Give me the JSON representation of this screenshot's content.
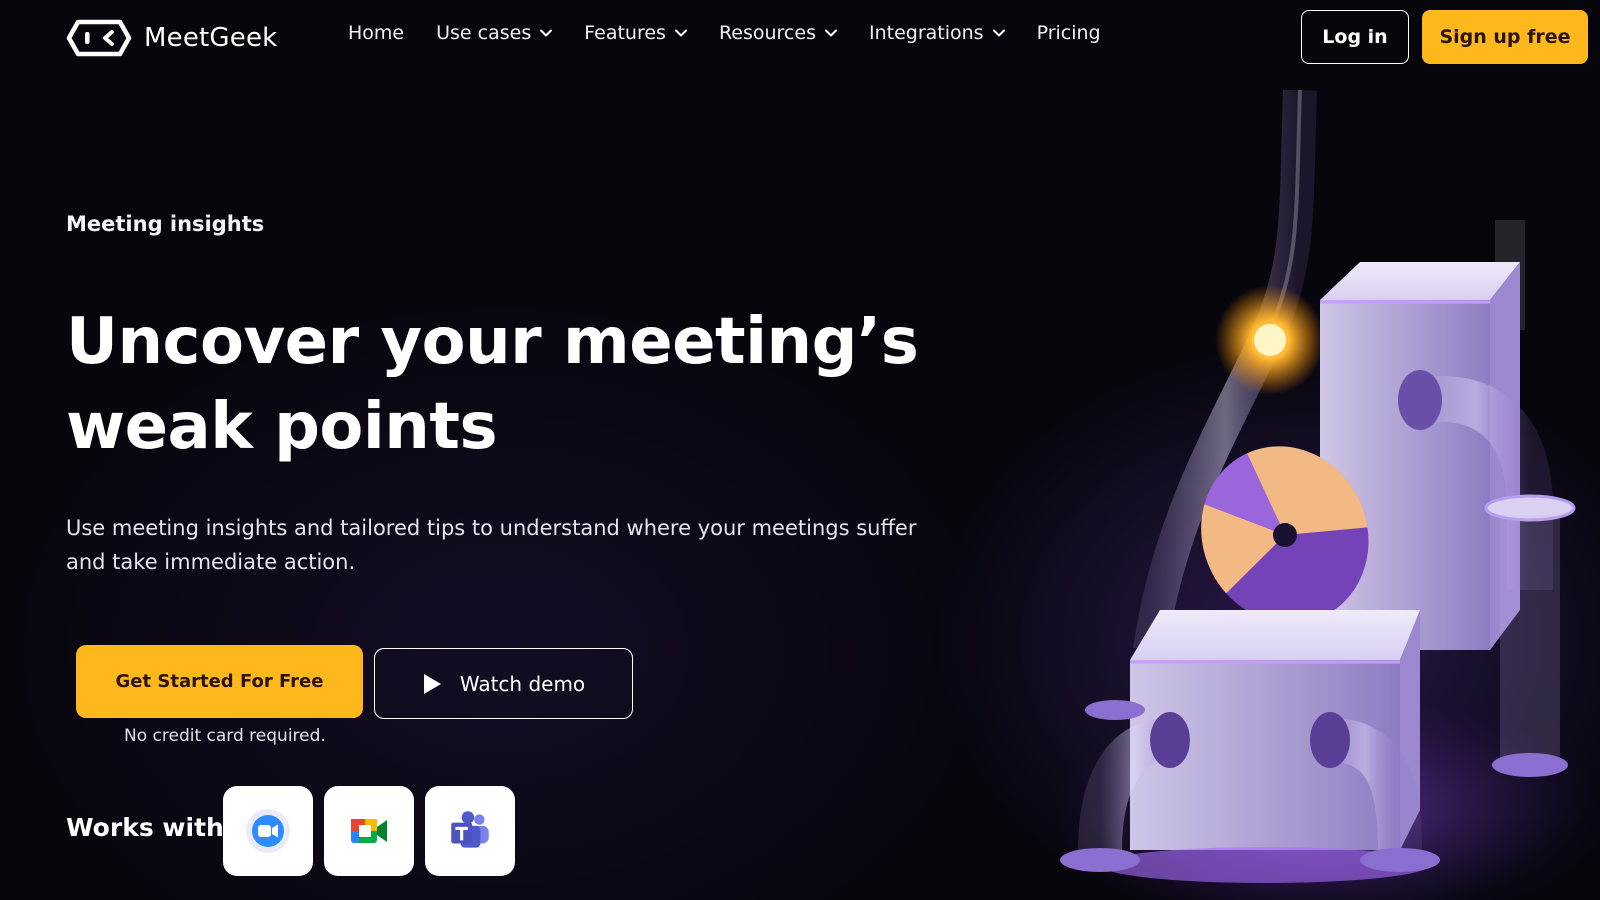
{
  "brand": {
    "name": "MeetGeek"
  },
  "nav": {
    "items": [
      {
        "label": "Home",
        "has_dropdown": false
      },
      {
        "label": "Use cases",
        "has_dropdown": true
      },
      {
        "label": "Features",
        "has_dropdown": true
      },
      {
        "label": "Resources",
        "has_dropdown": true
      },
      {
        "label": "Integrations",
        "has_dropdown": true
      },
      {
        "label": "Pricing",
        "has_dropdown": false
      }
    ],
    "login_label": "Log in",
    "signup_label": "Sign up free"
  },
  "hero": {
    "eyebrow": "Meeting insights",
    "headline_line1": "Uncover your meeting’s",
    "headline_line2": "weak points",
    "subcopy": "Use meeting insights and tailored tips to understand where your meetings suffer and take immediate action.",
    "cta_primary": "Get Started For Free",
    "cta_secondary": "Watch demo",
    "note": "No credit card required."
  },
  "works_with": {
    "label": "Works with",
    "apps": [
      "zoom-icon",
      "google-meet-icon",
      "microsoft-teams-icon"
    ]
  },
  "colors": {
    "accent": "#ffb81c",
    "background": "#07060d",
    "illustration_purple": "#8a55d6"
  }
}
